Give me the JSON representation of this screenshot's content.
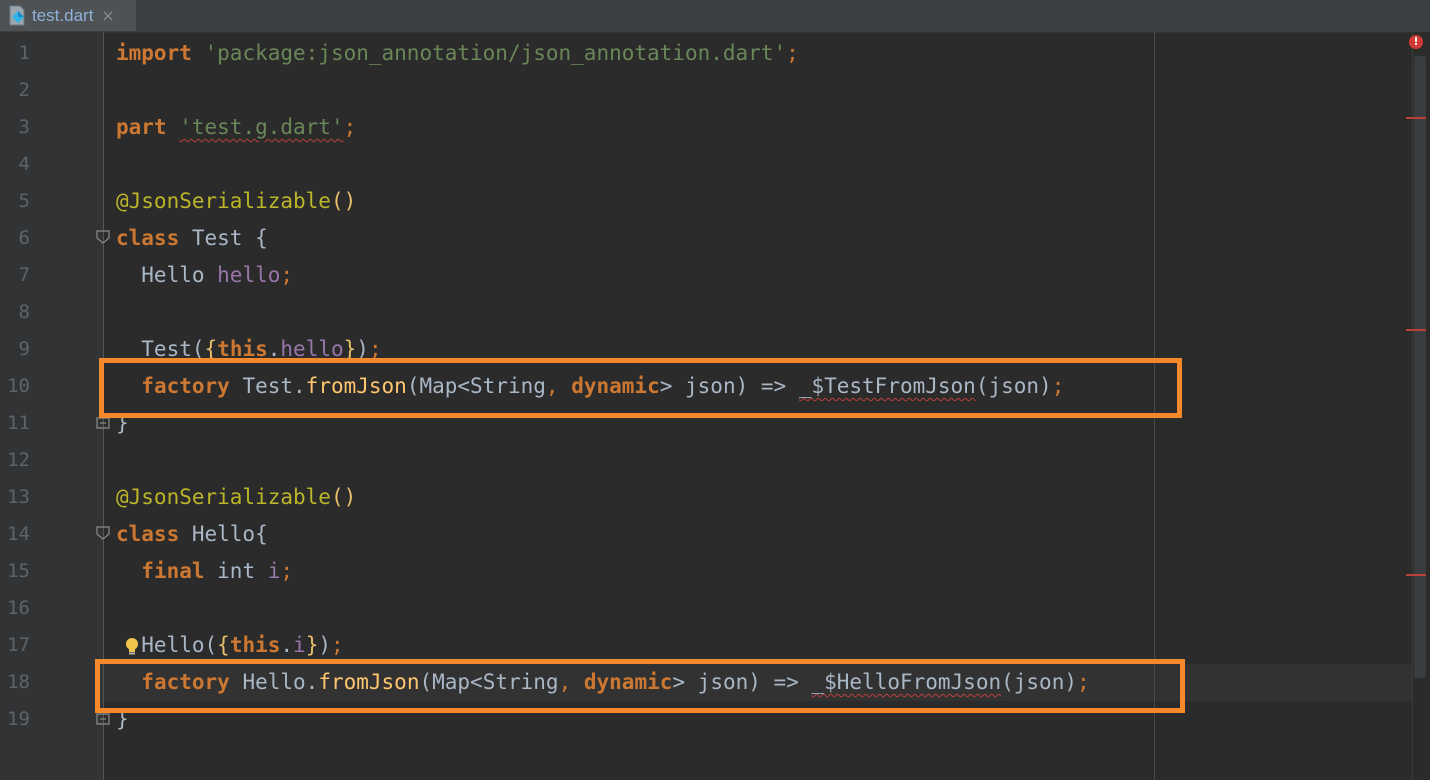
{
  "tab": {
    "filename": "test.dart",
    "close_glyph": "×",
    "icon": "dart-file-icon"
  },
  "inspection": {
    "error_glyph": "!",
    "icon": "error-indicator-icon"
  },
  "gutter": {
    "line_numbers": [
      "1",
      "2",
      "3",
      "4",
      "5",
      "6",
      "7",
      "8",
      "9",
      "10",
      "11",
      "12",
      "13",
      "14",
      "15",
      "16",
      "17",
      "18",
      "19"
    ]
  },
  "code": {
    "l1": {
      "kw": "import",
      "str": "'package:json_annotation/json_annotation.dart'",
      "semi": ";"
    },
    "l3": {
      "kw": "part",
      "str": "'test.g.dart'",
      "semi": ";"
    },
    "l5": {
      "ann": "@JsonSerializable",
      "parens": "()"
    },
    "l6": {
      "kw": "class",
      "name": " Test ",
      "brace": "{"
    },
    "l7": {
      "type": "  Hello ",
      "field": "hello",
      "semi": ";"
    },
    "l9": {
      "name": "  Test(",
      "brace_open": "{",
      "this": "this",
      "dot": ".",
      "field": "hello",
      "brace_close": "}",
      "rest": ")",
      "semi": ";"
    },
    "l10": {
      "indent": "  ",
      "kw": "factory",
      "cls": " Test.",
      "fn": "fromJson",
      "p1": "(Map<String",
      "comma": ",",
      "sp": " ",
      "kw2": "dynamic",
      "p2": "> json) => ",
      "call": "_$TestFromJson",
      "p3": "(json)",
      "semi": ";"
    },
    "l11": {
      "brace": "}"
    },
    "l13": {
      "ann": "@JsonSerializable",
      "parens": "()"
    },
    "l14": {
      "kw": "class",
      "name": " Hello",
      "brace": "{"
    },
    "l15": {
      "indent": "  ",
      "kw": "final",
      "type": " int ",
      "field": "i",
      "semi": ";"
    },
    "l17": {
      "name": "  Hello(",
      "brace_open": "{",
      "this": "this",
      "dot": ".",
      "field": "i",
      "brace_close": "}",
      "rest": ")",
      "semi": ";"
    },
    "l18": {
      "indent": "  ",
      "kw": "factory",
      "cls": " Hello.",
      "fn": "fromJson",
      "p1": "(Map<String",
      "comma": ",",
      "sp": " ",
      "kw2": "dynamic",
      "p2": "> json) => ",
      "call": "_$HelloFromJson",
      "p3": "(json)",
      "semi": ";"
    },
    "l19": {
      "brace": "}"
    }
  },
  "colors": {
    "keyword": "#cc7832",
    "string": "#6a8759",
    "annotation": "#bbb529",
    "field": "#9876aa",
    "function": "#ffc66d",
    "highlight_box": "#f6892c",
    "error": "#bc3f3c"
  }
}
